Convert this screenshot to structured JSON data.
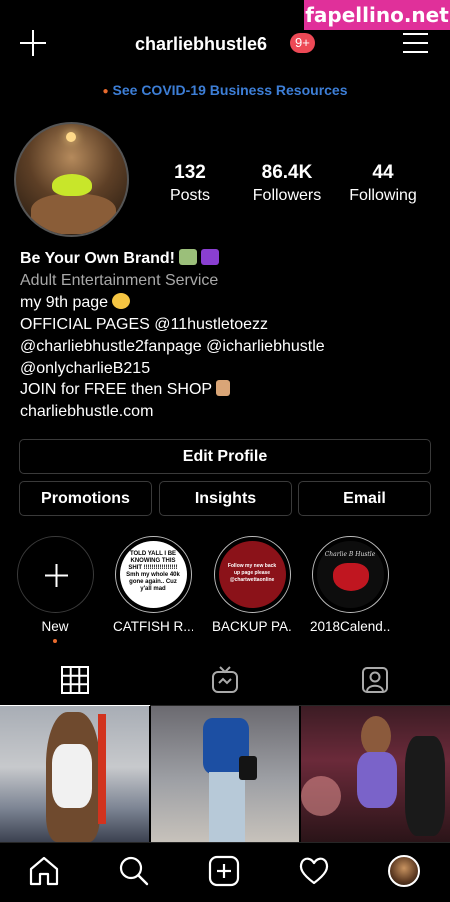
{
  "watermark": "fapellino.net",
  "header": {
    "username": "charliebhustle6",
    "notification_count": "9+",
    "icons": [
      "plus-icon",
      "hamburger-menu-icon"
    ]
  },
  "covid_banner": "See COVID-19 Business Resources",
  "stats": [
    {
      "value": "132",
      "label": "Posts"
    },
    {
      "value": "86.4K",
      "label": "Followers"
    },
    {
      "value": "44",
      "label": "Following"
    }
  ],
  "bio": {
    "name": "Be Your Own Brand!",
    "category": "Adult Entertainment Service",
    "lines": [
      "my 9th page",
      "OFFICIAL PAGES @11hustletoezz",
      "@charliebhustle2fanpage @icharliebhustle",
      "@onlycharlieB215",
      "JOIN for FREE then SHOP",
      "charliebhustle.com"
    ]
  },
  "buttons": {
    "edit_profile": "Edit Profile",
    "promotions": "Promotions",
    "insights": "Insights",
    "email": "Email"
  },
  "highlights": [
    {
      "label": "New",
      "story_text": ""
    },
    {
      "label": "CATFISH R...",
      "story_text": "TOLD YALL I BE KNOWING THIS SHIT !!!!!!!!!!!!!!!!! Smh my whole 40k gone again.. Cuz y'all mad"
    },
    {
      "label": "BACKUP PA...",
      "story_text": "Follow my new back up page please @chartwettaonline"
    },
    {
      "label": "2018Calend...",
      "story_text": "Charlie B Hustle"
    }
  ],
  "tabs": [
    "grid-icon",
    "igtv-icon",
    "tagged-icon"
  ],
  "nav": [
    "home-icon",
    "search-icon",
    "new-post-icon",
    "heart-icon",
    "profile-avatar"
  ],
  "colors": {
    "background": "#000000",
    "link_blue": "#3d7ed6",
    "badge_red": "#ed4956",
    "watermark_pink": "#e0309a",
    "dot_orange": "#e96b2e"
  }
}
